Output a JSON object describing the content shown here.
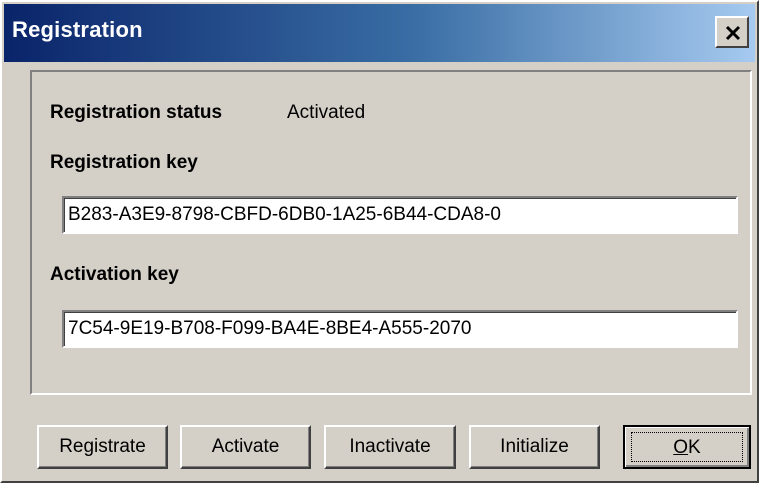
{
  "window": {
    "title": "Registration",
    "close_icon": "close-icon"
  },
  "status": {
    "label": "Registration status",
    "value": "Activated"
  },
  "registration_key": {
    "label": "Registration key",
    "value": "B283-A3E9-8798-CBFD-6DB0-1A25-6B44-CDA8-0"
  },
  "activation_key": {
    "label": "Activation key",
    "value": "7C54-9E19-B708-F099-BA4E-8BE4-A555-2070"
  },
  "buttons": {
    "registrate": "Registrate",
    "activate": "Activate",
    "inactivate": "Inactivate",
    "initialize": "Initialize",
    "ok_mnemonic": "O",
    "ok_rest": "K"
  }
}
